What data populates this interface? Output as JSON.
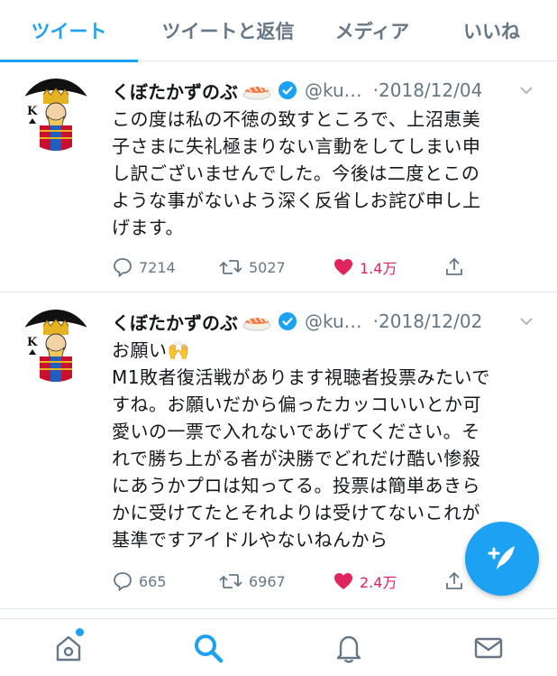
{
  "tabs": [
    "ツイート",
    "ツイートと返信",
    "メディア",
    "いいね"
  ],
  "colors": {
    "accent": "#1da1f2",
    "like": "#e0245e",
    "muted": "#657786"
  },
  "tweets": [
    {
      "name": "くぼたかずのぶ",
      "handle": "@ku…",
      "date": "·2018/12/04",
      "lines": [
        "この度は私の不徳の致すところで、上沼恵美",
        "子さまに失礼極まりない言動をしてしまい申",
        "し訳ございませんでした。今後は二度とこの",
        "ような事がないよう深く反省しお詫び申し上",
        "げます。"
      ],
      "replies": "7214",
      "retweets": "5027",
      "likes": "1.4万"
    },
    {
      "name": "くぼたかずのぶ",
      "handle": "@ku…",
      "date": "·2018/12/02",
      "lines": [
        "お願い🙌",
        "M1敗者復活戦があります視聴者投票みたいで",
        "すね。お願いだから偏ったカッコいいとか可",
        "愛いの一票で入れないであげてください。そ",
        "れで勝ち上がる者が決勝でどれだけ酷い惨殺",
        "にあうかプロは知ってる。投票は簡単あきら",
        "かに受けてたとそれよりは受けてないこれが",
        "基準ですアイドルやないねんから"
      ],
      "replies": "665",
      "retweets": "6967",
      "likes": "2.4万"
    }
  ],
  "icons": [
    "reply-icon",
    "retweet-icon",
    "heart-icon",
    "share-icon",
    "compose-icon",
    "home-icon",
    "search-icon",
    "notifications-icon",
    "messages-icon"
  ]
}
